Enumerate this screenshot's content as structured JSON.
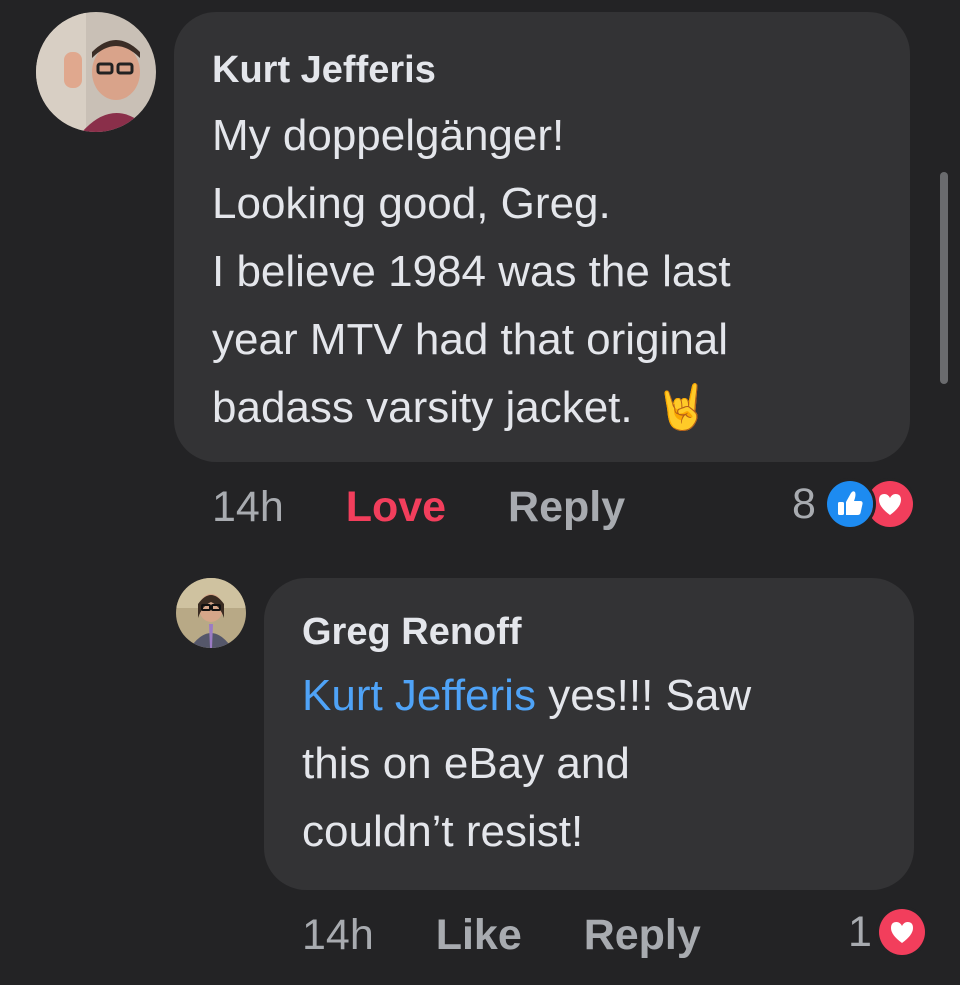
{
  "comments": [
    {
      "author": "Kurt Jefferis",
      "lines": [
        "My doppelgänger!",
        "Looking good, Greg.",
        "I believe 1984 was the last",
        "year MTV had that original",
        "badass varsity jacket."
      ],
      "emoji": "🤘",
      "time": "14h",
      "reaction_action": "Love",
      "reply_label": "Reply",
      "reaction_count": "8",
      "reaction_icons": [
        "like-icon",
        "love-icon"
      ]
    },
    {
      "author": "Greg Renoff",
      "mention": "Kurt Jefferis",
      "lines": [
        "yes!!! Saw",
        "this on eBay and",
        "couldn’t resist!"
      ],
      "time": "14h",
      "reaction_action": "Like",
      "reply_label": "Reply",
      "reaction_count": "1",
      "reaction_icons": [
        "love-icon"
      ]
    }
  ],
  "colors": {
    "background": "#232325",
    "bubble": "#333335",
    "love": "#f23e5c",
    "mention": "#4fa3f7",
    "like_blue": "#1d8bf1"
  }
}
